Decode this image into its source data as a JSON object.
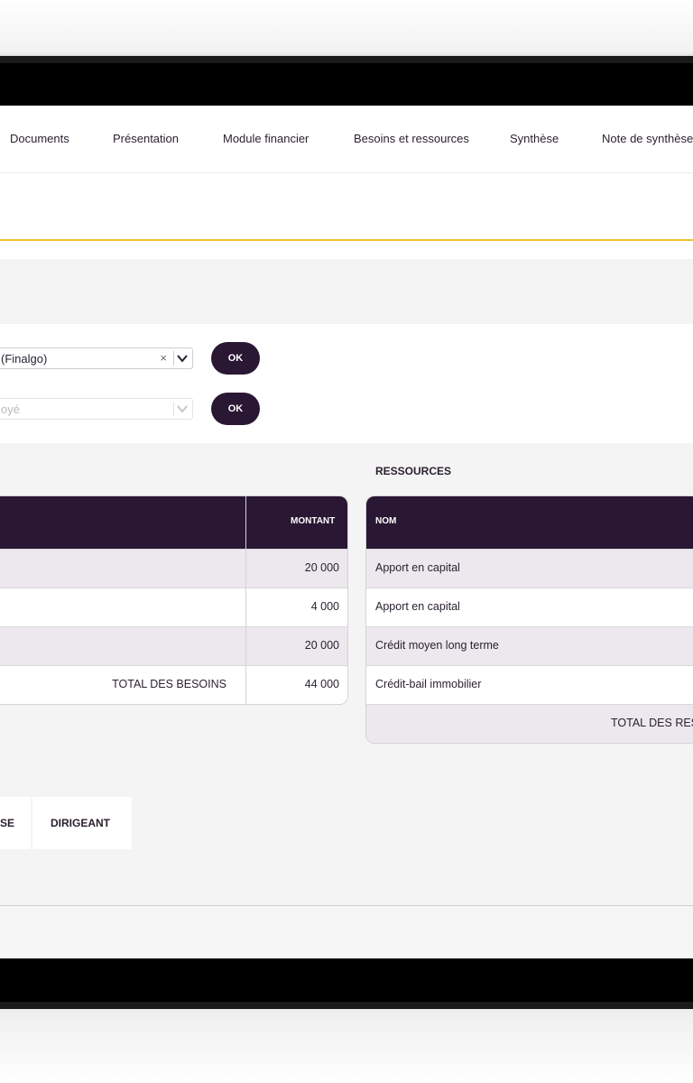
{
  "nav": {
    "items": [
      "Documents",
      "Présentation",
      "Module financier",
      "Besoins et ressources",
      "Synthèse",
      "Note de synthèse"
    ]
  },
  "form": {
    "select1": {
      "value": "(Finalgo)",
      "clear": "×",
      "ok": "OK"
    },
    "select2": {
      "placeholder": "oyé",
      "ok": "OK"
    }
  },
  "besoins": {
    "header": {
      "montant": "MONTANT"
    },
    "rows": [
      {
        "label": "",
        "amount": "20 000"
      },
      {
        "label": "",
        "amount": "4 000"
      },
      {
        "label": "",
        "amount": "20 000"
      }
    ],
    "total": {
      "label": "TOTAL DES BESOINS",
      "amount": "44 000"
    }
  },
  "ressources": {
    "title": "RESSOURCES",
    "header": {
      "nom": "NOM"
    },
    "rows": [
      {
        "name": "Apport en capital"
      },
      {
        "name": "Apport en capital"
      },
      {
        "name": "Crédit moyen long terme"
      },
      {
        "name": "Crédit-bail immobilier"
      }
    ],
    "total": {
      "label": "TOTAL DES RES"
    }
  },
  "tabs": [
    "SE",
    "DIRIGEANT"
  ]
}
